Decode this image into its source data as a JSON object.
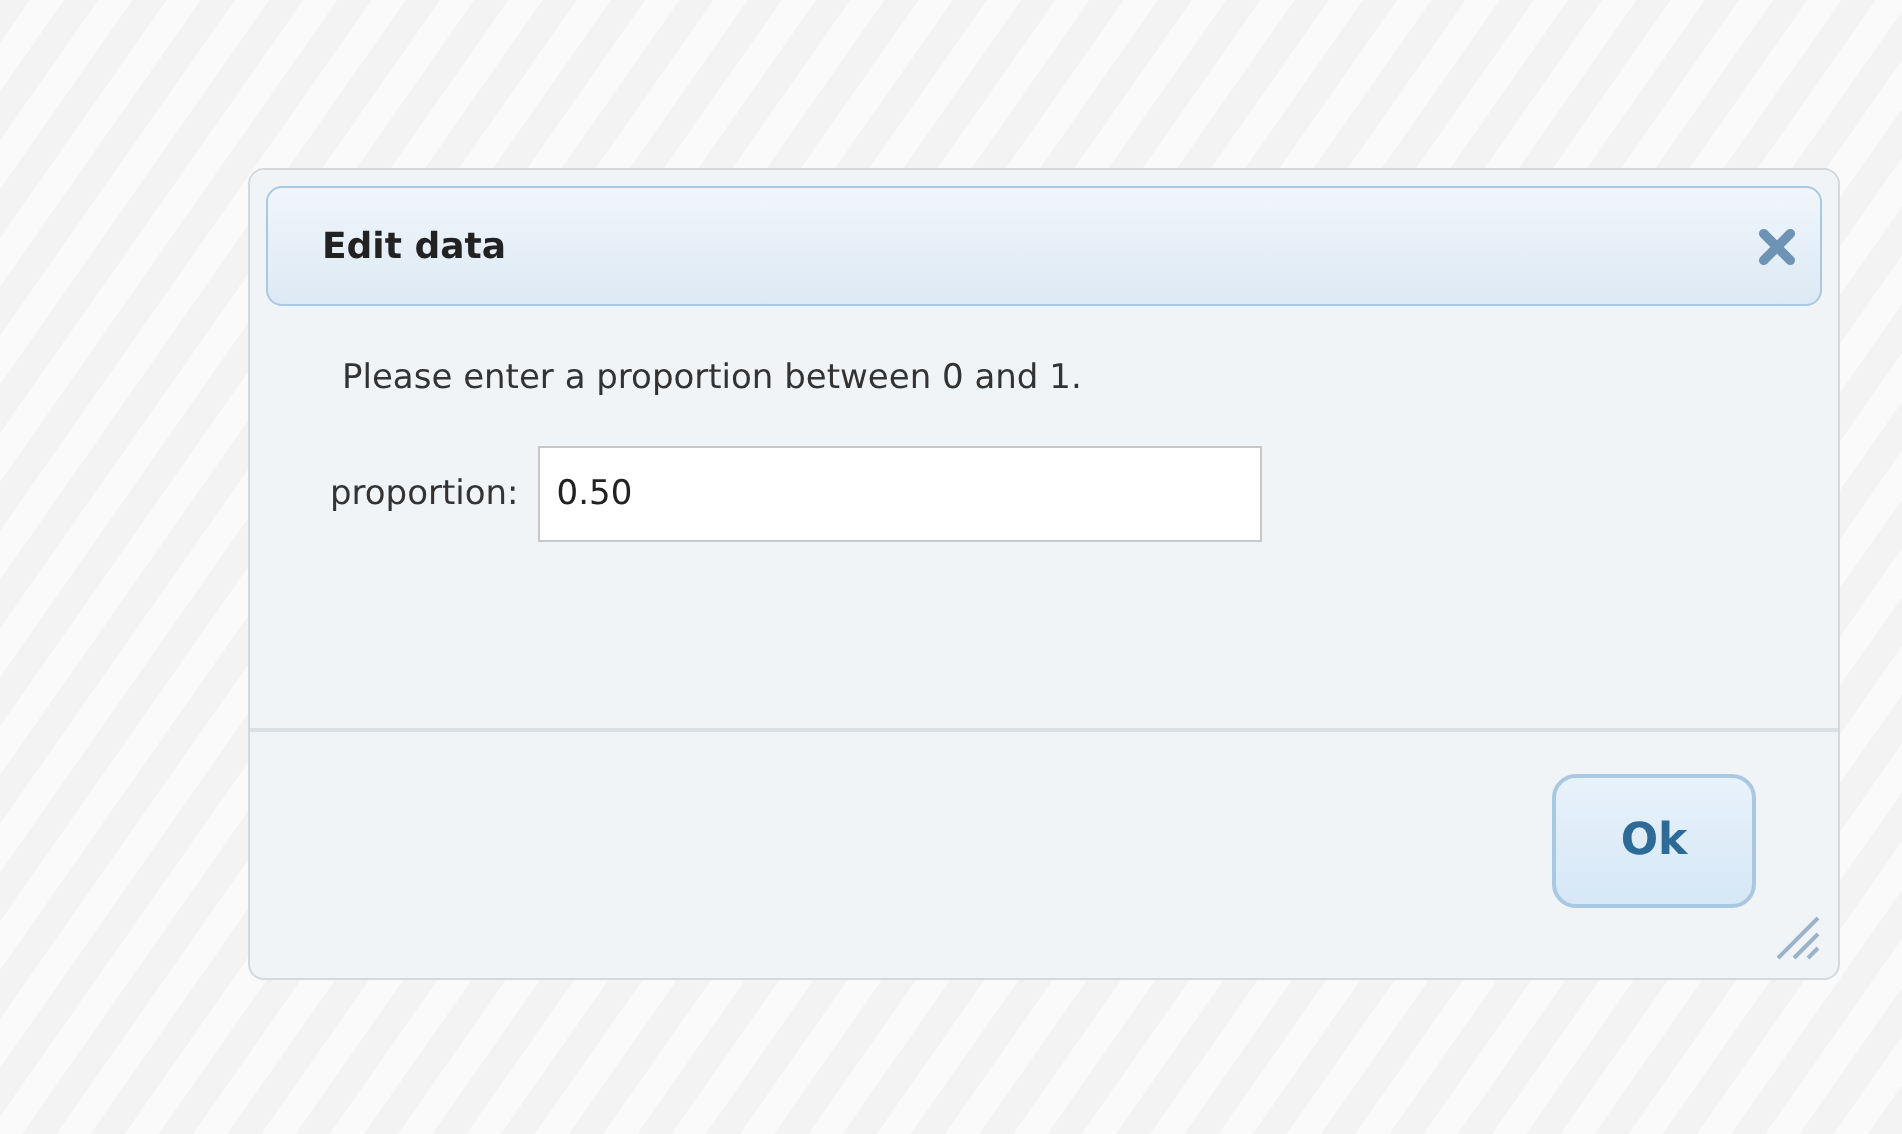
{
  "dialog": {
    "title": "Edit data",
    "message": "Please enter a proportion between 0 and 1.",
    "field": {
      "label": "proportion:",
      "value": "0.50"
    },
    "buttons": [
      "Ok"
    ]
  }
}
